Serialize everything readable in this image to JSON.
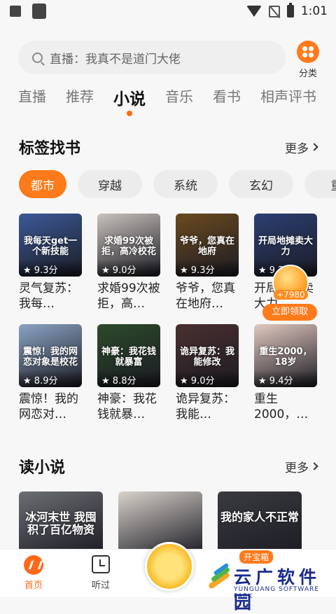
{
  "status_bar": {
    "time": "1:01"
  },
  "search": {
    "placeholder": "直播：我真不是道门大佬"
  },
  "category": {
    "label": "分类"
  },
  "tabs": [
    {
      "label": "直播"
    },
    {
      "label": "推荐"
    },
    {
      "label": "小说"
    },
    {
      "label": "音乐"
    },
    {
      "label": "看书"
    },
    {
      "label": "相声评书"
    }
  ],
  "tag_section": {
    "title": "标签找书",
    "more": "更多"
  },
  "chips": [
    {
      "label": "都市"
    },
    {
      "label": "穿越"
    },
    {
      "label": "系统"
    },
    {
      "label": "玄幻"
    },
    {
      "label": "重"
    }
  ],
  "books": [
    {
      "cover_text": "我每天get一个新技能",
      "rating": "9.3分",
      "title": "灵气复苏：我每…",
      "color": "#3b5998"
    },
    {
      "cover_text": "求婚99次被拒，高冷校花",
      "rating": "9.0分",
      "title": "求婚99次被拒，高…",
      "color": "#c9c2bd"
    },
    {
      "cover_text": "爷爷，您真在地府",
      "rating": "9.3分",
      "title": "爷爷，您真在地府…",
      "color": "#6b4a1f"
    },
    {
      "cover_text": "开局地摊卖大力",
      "rating": "9.2分",
      "title": "开局地摊卖大力",
      "color": "#2b3f73"
    },
    {
      "cover_text": "震惊！我的网恋对象是校花",
      "rating": "8.9分",
      "title": "震惊！我的网恋对…",
      "color": "#8aa3c2"
    },
    {
      "cover_text": "神豪：我花钱就暴富",
      "rating": "8.8分",
      "title": "神豪：我花钱就暴…",
      "color": "#2c4a2a"
    },
    {
      "cover_text": "诡异复苏：我能修改",
      "rating": "9.0分",
      "title": "诡异复苏：我能…",
      "color": "#4a2f2f"
    },
    {
      "cover_text": "重生2000，18岁",
      "rating": "9.4分",
      "title": "重生2000，…",
      "color": "#e2c9c0"
    }
  ],
  "reward": {
    "amount": "+7980",
    "button": "立即领取"
  },
  "read_section": {
    "title": "读小说",
    "more": "更多"
  },
  "read_books": [
    {
      "cover_text": "冰河末世 我囤积了百亿物资",
      "color": "#6b6e73"
    },
    {
      "cover_text": "",
      "color": "#d9d3cc"
    },
    {
      "cover_text": "我的家人不正常",
      "color": "#3a3b40"
    }
  ],
  "bottom_nav": {
    "home": "首页",
    "listen": "听过",
    "treasure": "开宝箱"
  },
  "watermark": {
    "main": "云广软件园",
    "sub": "YUNGUANG SOFTWARE PARK"
  },
  "colors": {
    "accent": "#ff7a1a",
    "active_chip": "#ff7a1a"
  }
}
